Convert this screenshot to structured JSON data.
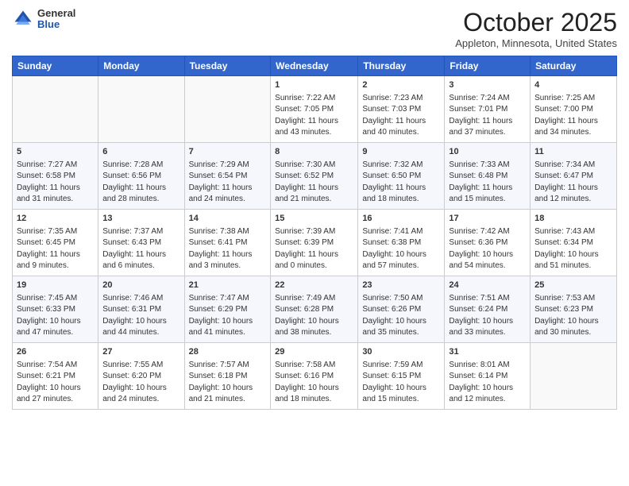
{
  "header": {
    "logo": {
      "general": "General",
      "blue": "Blue"
    },
    "title": "October 2025",
    "subtitle": "Appleton, Minnesota, United States"
  },
  "calendar": {
    "days_of_week": [
      "Sunday",
      "Monday",
      "Tuesday",
      "Wednesday",
      "Thursday",
      "Friday",
      "Saturday"
    ],
    "weeks": [
      [
        {
          "day": "",
          "info": ""
        },
        {
          "day": "",
          "info": ""
        },
        {
          "day": "",
          "info": ""
        },
        {
          "day": "1",
          "info": "Sunrise: 7:22 AM\nSunset: 7:05 PM\nDaylight: 11 hours and 43 minutes."
        },
        {
          "day": "2",
          "info": "Sunrise: 7:23 AM\nSunset: 7:03 PM\nDaylight: 11 hours and 40 minutes."
        },
        {
          "day": "3",
          "info": "Sunrise: 7:24 AM\nSunset: 7:01 PM\nDaylight: 11 hours and 37 minutes."
        },
        {
          "day": "4",
          "info": "Sunrise: 7:25 AM\nSunset: 7:00 PM\nDaylight: 11 hours and 34 minutes."
        }
      ],
      [
        {
          "day": "5",
          "info": "Sunrise: 7:27 AM\nSunset: 6:58 PM\nDaylight: 11 hours and 31 minutes."
        },
        {
          "day": "6",
          "info": "Sunrise: 7:28 AM\nSunset: 6:56 PM\nDaylight: 11 hours and 28 minutes."
        },
        {
          "day": "7",
          "info": "Sunrise: 7:29 AM\nSunset: 6:54 PM\nDaylight: 11 hours and 24 minutes."
        },
        {
          "day": "8",
          "info": "Sunrise: 7:30 AM\nSunset: 6:52 PM\nDaylight: 11 hours and 21 minutes."
        },
        {
          "day": "9",
          "info": "Sunrise: 7:32 AM\nSunset: 6:50 PM\nDaylight: 11 hours and 18 minutes."
        },
        {
          "day": "10",
          "info": "Sunrise: 7:33 AM\nSunset: 6:48 PM\nDaylight: 11 hours and 15 minutes."
        },
        {
          "day": "11",
          "info": "Sunrise: 7:34 AM\nSunset: 6:47 PM\nDaylight: 11 hours and 12 minutes."
        }
      ],
      [
        {
          "day": "12",
          "info": "Sunrise: 7:35 AM\nSunset: 6:45 PM\nDaylight: 11 hours and 9 minutes."
        },
        {
          "day": "13",
          "info": "Sunrise: 7:37 AM\nSunset: 6:43 PM\nDaylight: 11 hours and 6 minutes."
        },
        {
          "day": "14",
          "info": "Sunrise: 7:38 AM\nSunset: 6:41 PM\nDaylight: 11 hours and 3 minutes."
        },
        {
          "day": "15",
          "info": "Sunrise: 7:39 AM\nSunset: 6:39 PM\nDaylight: 11 hours and 0 minutes."
        },
        {
          "day": "16",
          "info": "Sunrise: 7:41 AM\nSunset: 6:38 PM\nDaylight: 10 hours and 57 minutes."
        },
        {
          "day": "17",
          "info": "Sunrise: 7:42 AM\nSunset: 6:36 PM\nDaylight: 10 hours and 54 minutes."
        },
        {
          "day": "18",
          "info": "Sunrise: 7:43 AM\nSunset: 6:34 PM\nDaylight: 10 hours and 51 minutes."
        }
      ],
      [
        {
          "day": "19",
          "info": "Sunrise: 7:45 AM\nSunset: 6:33 PM\nDaylight: 10 hours and 47 minutes."
        },
        {
          "day": "20",
          "info": "Sunrise: 7:46 AM\nSunset: 6:31 PM\nDaylight: 10 hours and 44 minutes."
        },
        {
          "day": "21",
          "info": "Sunrise: 7:47 AM\nSunset: 6:29 PM\nDaylight: 10 hours and 41 minutes."
        },
        {
          "day": "22",
          "info": "Sunrise: 7:49 AM\nSunset: 6:28 PM\nDaylight: 10 hours and 38 minutes."
        },
        {
          "day": "23",
          "info": "Sunrise: 7:50 AM\nSunset: 6:26 PM\nDaylight: 10 hours and 35 minutes."
        },
        {
          "day": "24",
          "info": "Sunrise: 7:51 AM\nSunset: 6:24 PM\nDaylight: 10 hours and 33 minutes."
        },
        {
          "day": "25",
          "info": "Sunrise: 7:53 AM\nSunset: 6:23 PM\nDaylight: 10 hours and 30 minutes."
        }
      ],
      [
        {
          "day": "26",
          "info": "Sunrise: 7:54 AM\nSunset: 6:21 PM\nDaylight: 10 hours and 27 minutes."
        },
        {
          "day": "27",
          "info": "Sunrise: 7:55 AM\nSunset: 6:20 PM\nDaylight: 10 hours and 24 minutes."
        },
        {
          "day": "28",
          "info": "Sunrise: 7:57 AM\nSunset: 6:18 PM\nDaylight: 10 hours and 21 minutes."
        },
        {
          "day": "29",
          "info": "Sunrise: 7:58 AM\nSunset: 6:16 PM\nDaylight: 10 hours and 18 minutes."
        },
        {
          "day": "30",
          "info": "Sunrise: 7:59 AM\nSunset: 6:15 PM\nDaylight: 10 hours and 15 minutes."
        },
        {
          "day": "31",
          "info": "Sunrise: 8:01 AM\nSunset: 6:14 PM\nDaylight: 10 hours and 12 minutes."
        },
        {
          "day": "",
          "info": ""
        }
      ]
    ]
  }
}
